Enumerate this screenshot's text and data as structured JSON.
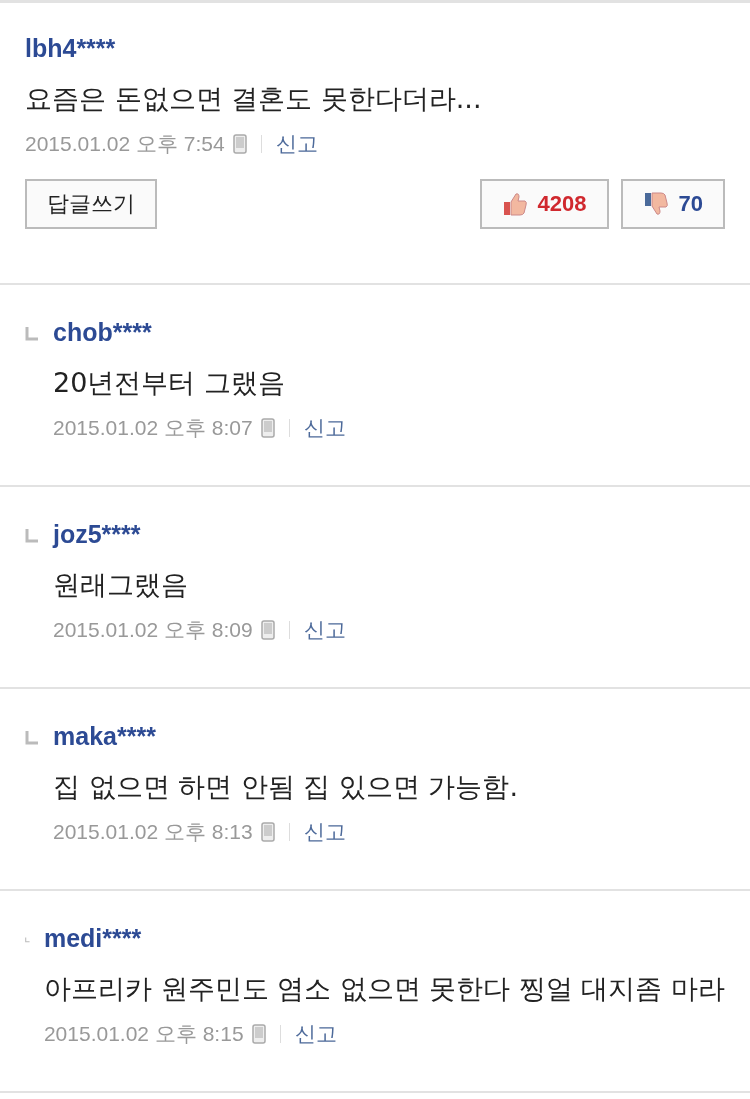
{
  "comment": {
    "author": "lbh4****",
    "text": "요즘은 돈없으면 결혼도 못한다더라...",
    "date": "2015.01.02 오후 7:54",
    "report": "신고",
    "reply_button": "답글쓰기",
    "likes": "4208",
    "dislikes": "70"
  },
  "replies": [
    {
      "author": "chob****",
      "text": "20년전부터 그랬음",
      "date": "2015.01.02 오후 8:07",
      "report": "신고"
    },
    {
      "author": "joz5****",
      "text": "원래그랬음",
      "date": "2015.01.02 오후 8:09",
      "report": "신고"
    },
    {
      "author": "maka****",
      "text": "집 없으면 하면 안됨 집 있으면 가능함.",
      "date": "2015.01.02 오후 8:13",
      "report": "신고"
    },
    {
      "author": "medi****",
      "text": "아프리카 원주민도 염소 없으면 못한다 찡얼 대지좀 마라",
      "date": "2015.01.02 오후 8:15",
      "report": "신고"
    }
  ]
}
